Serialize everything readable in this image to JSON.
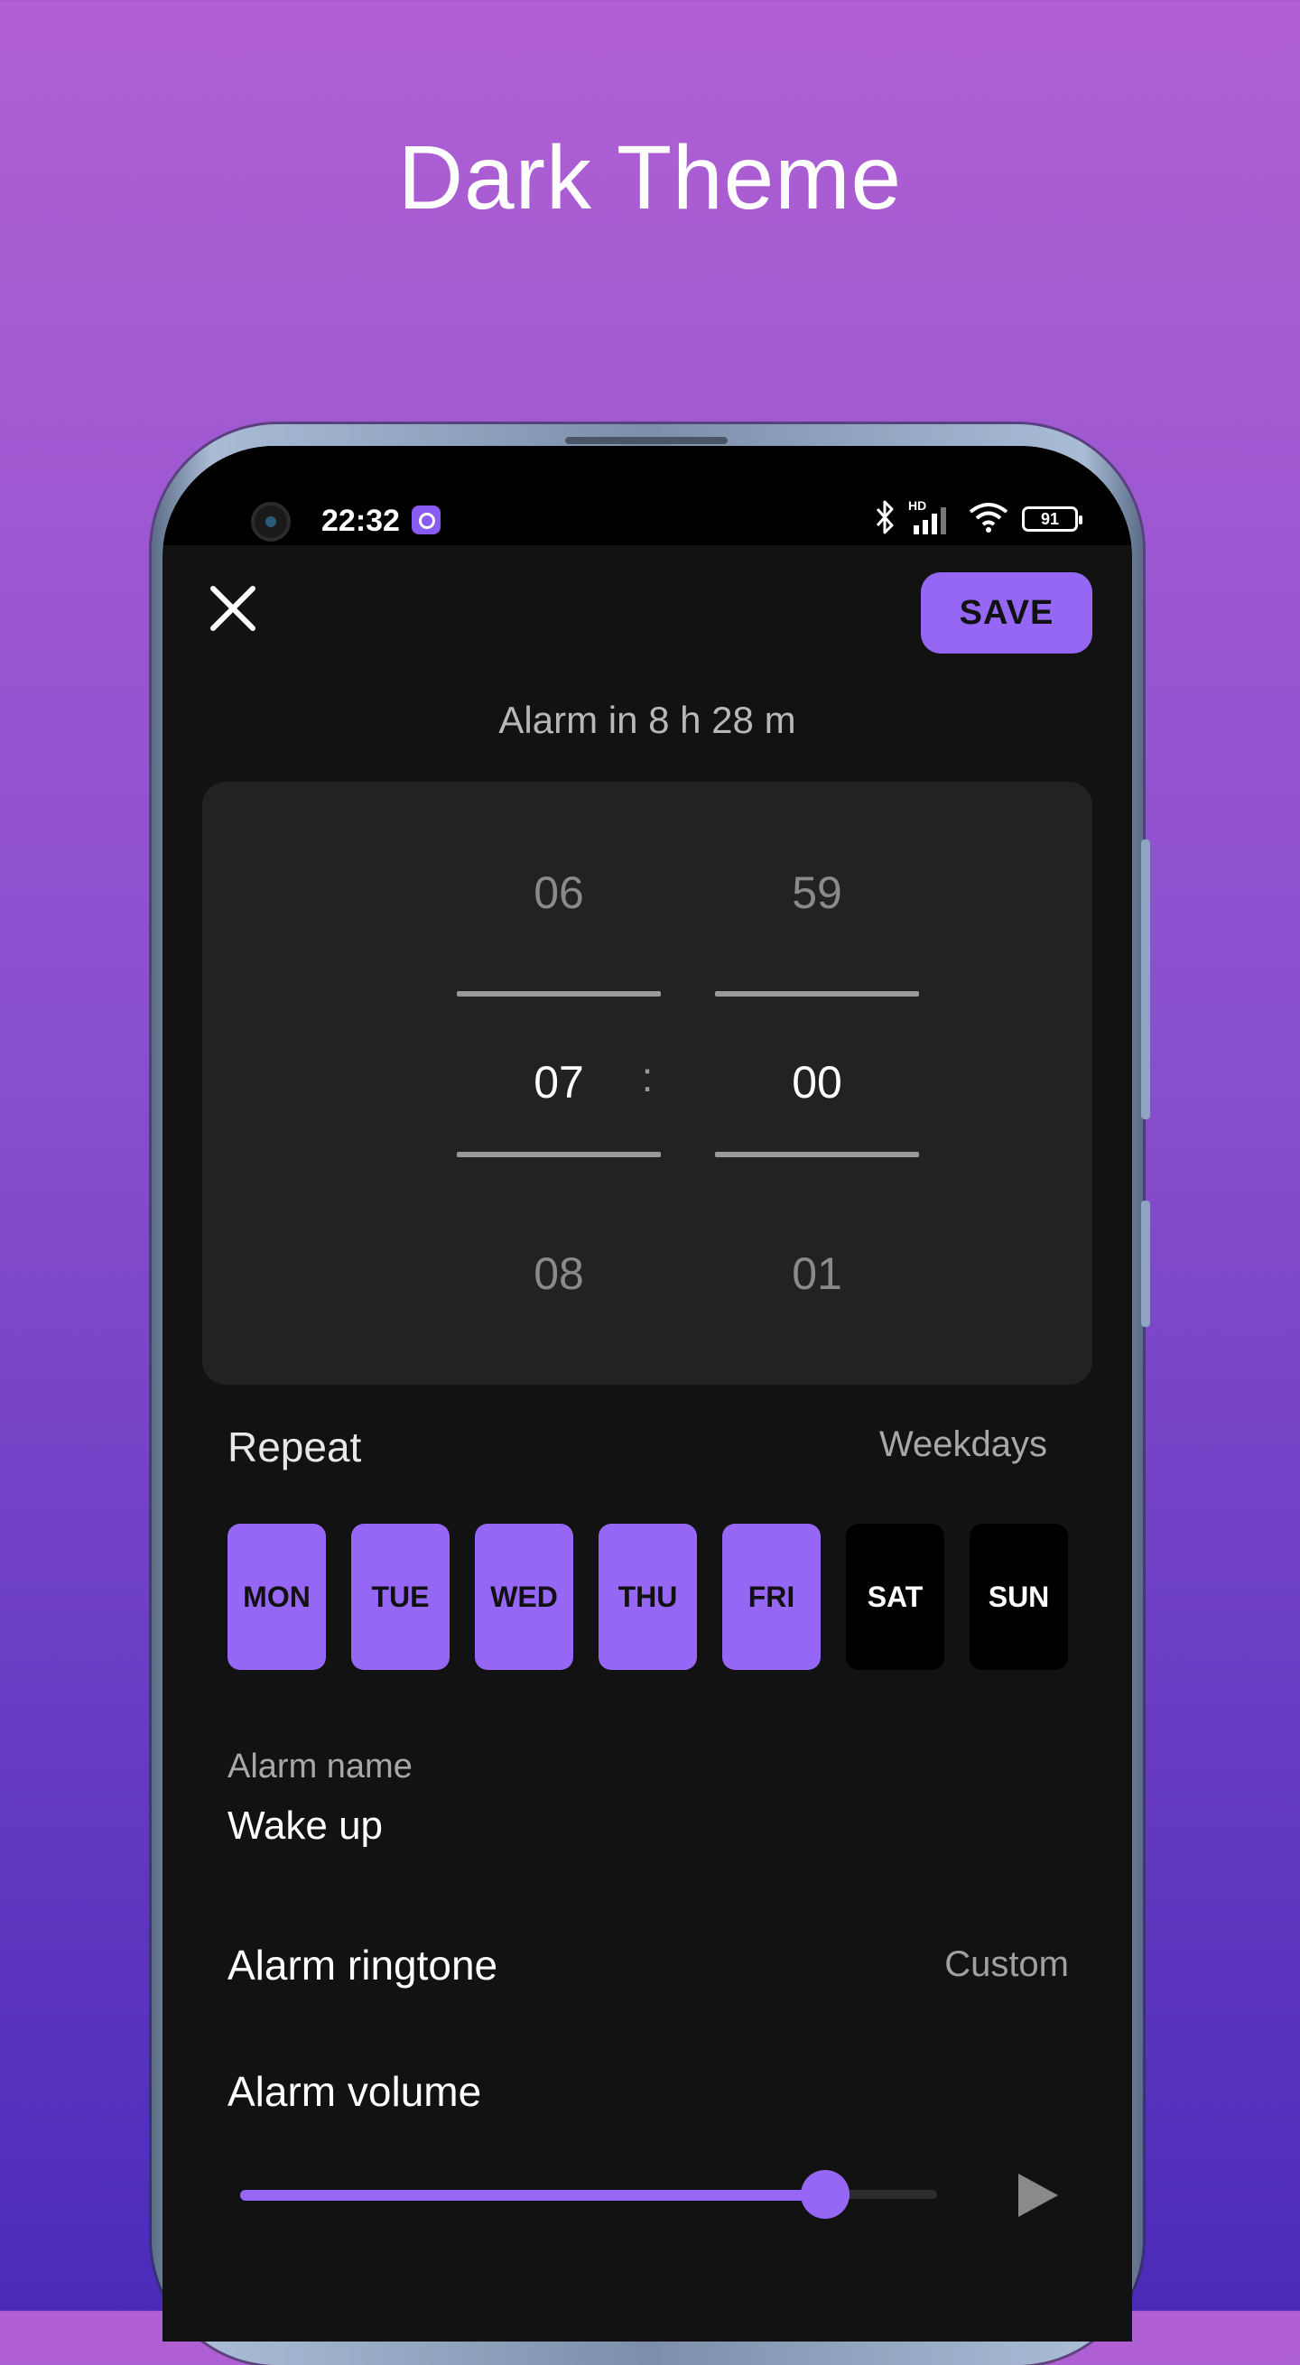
{
  "promo": {
    "title": "Dark Theme"
  },
  "status_bar": {
    "time": "22:32",
    "battery": "91",
    "network_label": "HD"
  },
  "header": {
    "save_label": "SAVE",
    "alarm_in": "Alarm in 8 h 28 m"
  },
  "time_picker": {
    "hour": {
      "previous": "06",
      "current": "07",
      "next": "08"
    },
    "minute": {
      "previous": "59",
      "current": "00",
      "next": "01"
    },
    "separator": ":"
  },
  "repeat": {
    "label": "Repeat",
    "value": "Weekdays",
    "days": [
      {
        "label": "MON",
        "selected": true
      },
      {
        "label": "TUE",
        "selected": true
      },
      {
        "label": "WED",
        "selected": true
      },
      {
        "label": "THU",
        "selected": true
      },
      {
        "label": "FRI",
        "selected": true
      },
      {
        "label": "SAT",
        "selected": false
      },
      {
        "label": "SUN",
        "selected": false
      }
    ]
  },
  "alarm_name": {
    "label": "Alarm name",
    "value": "Wake up"
  },
  "ringtone": {
    "label": "Alarm ringtone",
    "value": "Custom"
  },
  "volume": {
    "label": "Alarm volume",
    "level": 0.84
  },
  "colors": {
    "accent": "#9567f4",
    "background": "#121212",
    "card": "#222222",
    "promo_top": "#b160d4",
    "promo_bottom": "#4a2bb8"
  },
  "icons": [
    "close-icon",
    "play-icon",
    "bluetooth-icon",
    "signal-icon",
    "wifi-icon",
    "battery-icon",
    "alarm-app-icon",
    "camera-cutout"
  ]
}
